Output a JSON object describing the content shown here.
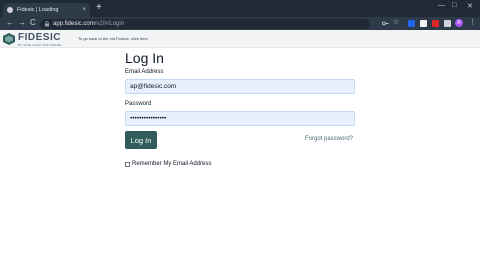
{
  "browser": {
    "tab_title": "Fidesic | Loading",
    "tab_close": "×",
    "new_tab": "+",
    "url_host": "app.fidesic.com",
    "url_path": "/v2/#/Login",
    "nav_back": "←",
    "nav_forward": "→",
    "nav_reload": "C",
    "win_min": "—",
    "win_max": "□",
    "win_close": "✕",
    "profile_initial": "R"
  },
  "header": {
    "logo_text": "FIDESIC",
    "logo_subtitle": "BY ONE VIEW SOFTWARE",
    "back_link": "To go back to the old Fidesic, click here."
  },
  "login": {
    "title": "Log In",
    "email_label": "Email Address",
    "email_value": "ap@fidesic.com",
    "password_label": "Password",
    "password_value": "••••••••••••••••",
    "login_button": "Log In",
    "forgot_link": "Forgot password?",
    "remember_label": "Remember My Email Address",
    "remember_checked": false
  },
  "colors": {
    "login_button": "#2f5d5b",
    "field_autofill": "#e8f0fe"
  }
}
